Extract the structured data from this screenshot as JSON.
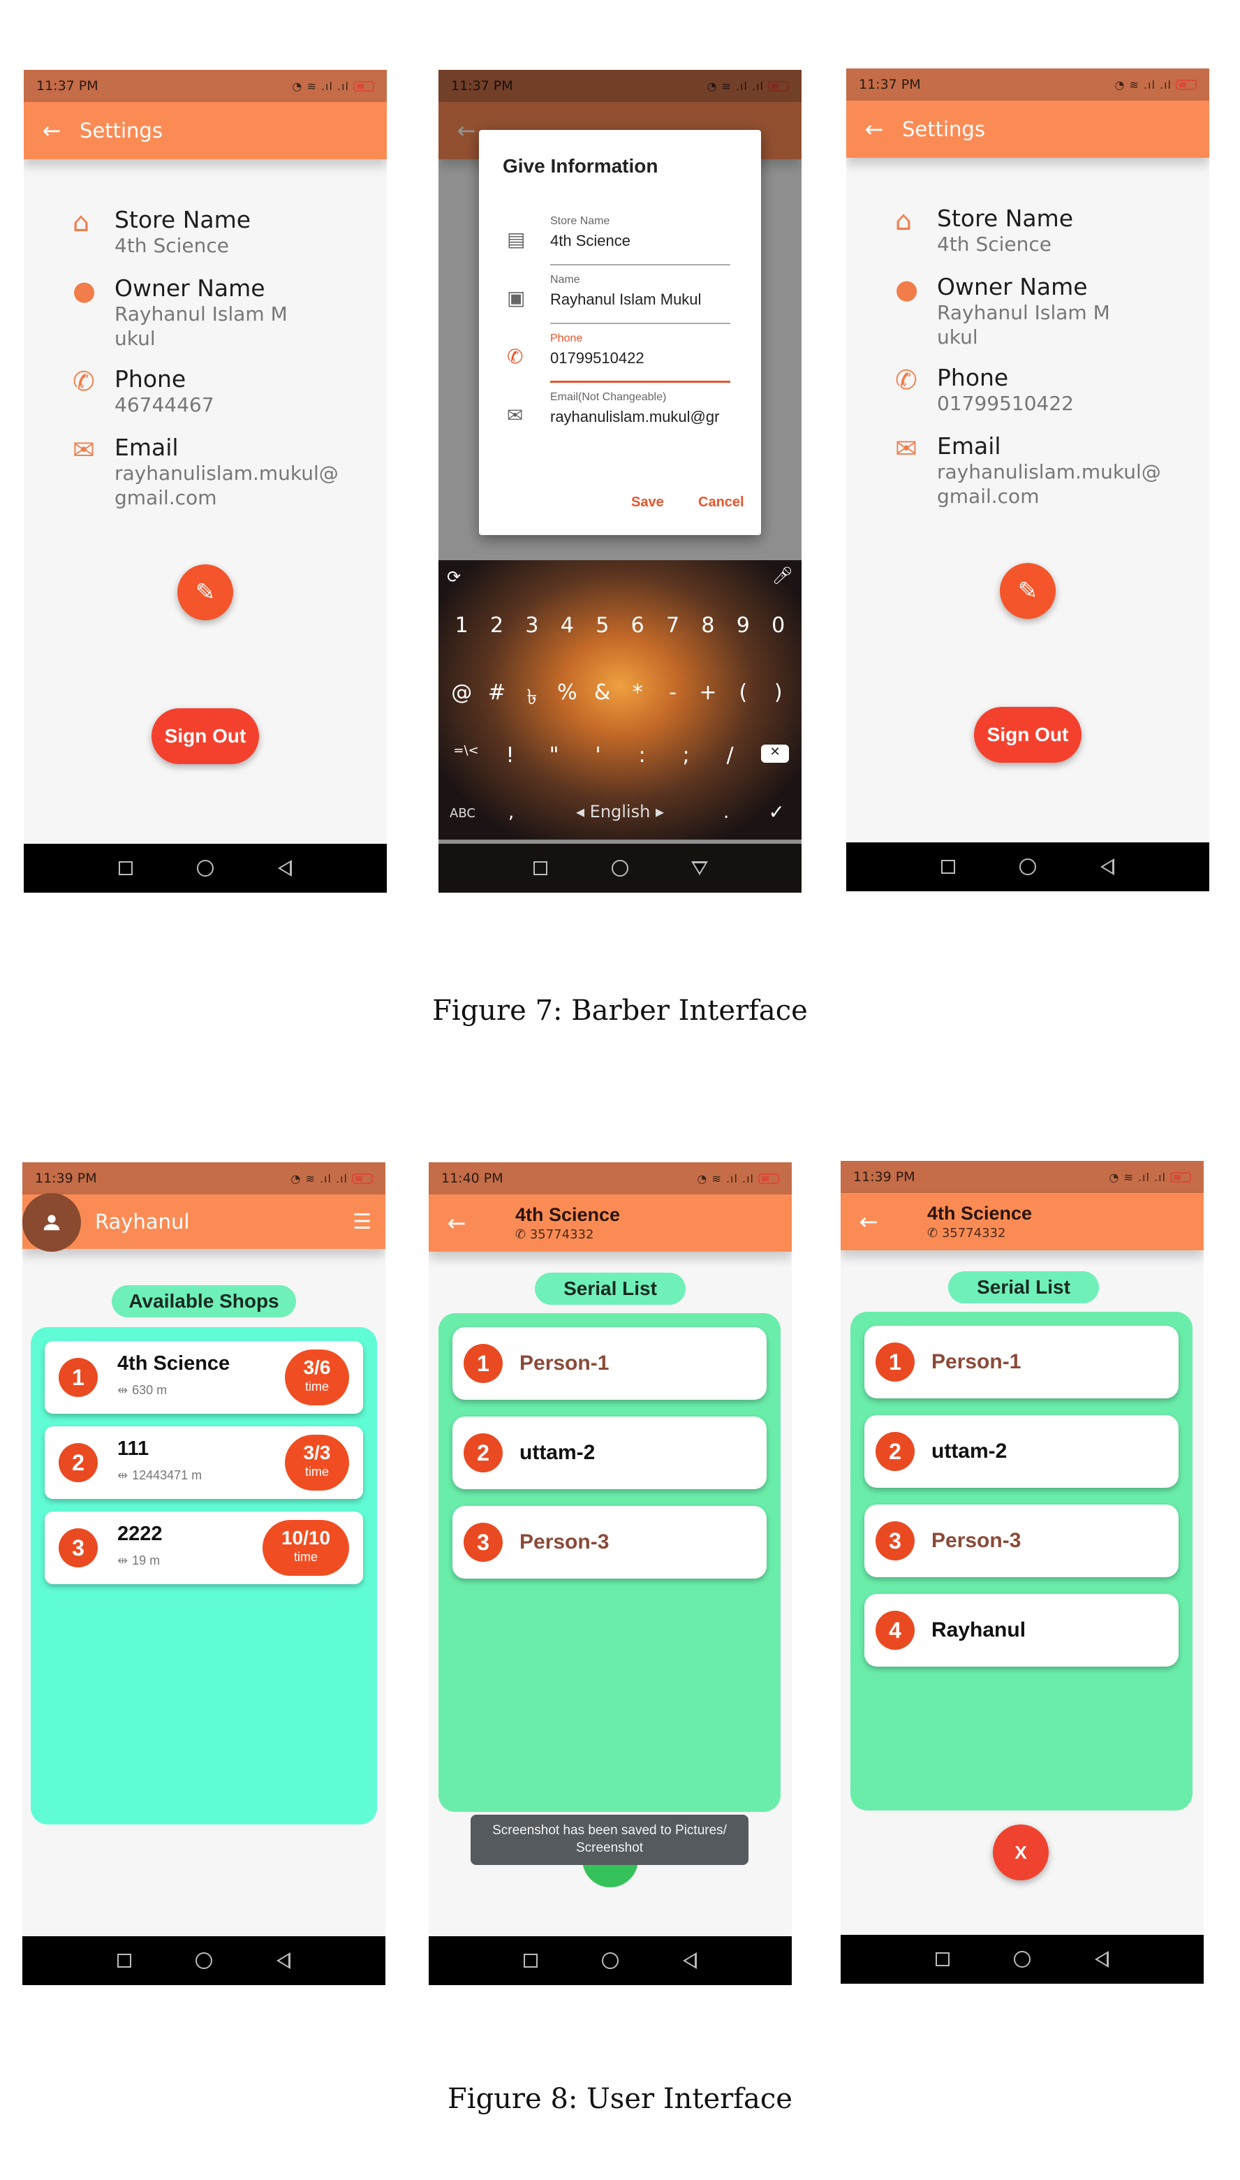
{
  "status": {
    "time_1137": "11:37 PM",
    "time_1139": "11:39 PM",
    "time_1140": "11:40 PM"
  },
  "settings": {
    "title": "Settings",
    "store_label": "Store Name",
    "store_value": "4th Science",
    "owner_label": "Owner Name",
    "owner_value": "Rayhanul Islam Mukul",
    "phone_label": "Phone",
    "phone_value_before": "46744467",
    "phone_value_after": "01799510422",
    "email_label": "Email",
    "email_value": "rayhanulislam.mukul@gmail.com",
    "sign_out": "Sign Out"
  },
  "dialog": {
    "title": "Give Information",
    "fields": [
      {
        "label": "Store Name",
        "value": "4th Science"
      },
      {
        "label": "Name",
        "value": "Rayhanul Islam Mukul"
      },
      {
        "label": "Phone",
        "value": "01799510422"
      },
      {
        "label": "Email(Not Changeable)",
        "value": "rayhanulislam.mukul@gr"
      }
    ],
    "save": "Save",
    "cancel": "Cancel"
  },
  "keyboard": {
    "digits": [
      "1",
      "2",
      "3",
      "4",
      "5",
      "6",
      "7",
      "8",
      "9",
      "0"
    ],
    "symbols_row": [
      "@",
      "#",
      "৳",
      "%",
      "&",
      "*",
      "-",
      "+",
      "(",
      ")"
    ],
    "punct_row": [
      "=\\<",
      "!",
      "\"",
      "'",
      ":",
      ";",
      "/",
      "?"
    ],
    "abc": "ABC",
    "comma": ",",
    "space_label": "English",
    "period": "."
  },
  "captions": {
    "fig7": "Figure 7: Barber Interface",
    "fig8": "Figure 8: User Interface"
  },
  "user": {
    "name": "Rayhanul",
    "available_shops": "Available Shops",
    "shops": [
      {
        "num": "1",
        "name": "4th Science",
        "dist": "630 m",
        "badge": "3/6",
        "badge_sub": "time"
      },
      {
        "num": "2",
        "name": "111",
        "dist": "12443471 m",
        "badge": "3/3",
        "badge_sub": "time"
      },
      {
        "num": "3",
        "name": "2222",
        "dist": "19 m",
        "badge": "10/10",
        "badge_sub": "time"
      }
    ]
  },
  "serial": {
    "shop_title": "4th Science",
    "shop_phone": "35774332",
    "list_title": "Serial List",
    "list_a": [
      {
        "num": "1",
        "name": "Person-1"
      },
      {
        "num": "2",
        "name": "uttam-2"
      },
      {
        "num": "3",
        "name": "Person-3"
      }
    ],
    "list_b": [
      {
        "num": "1",
        "name": "Person-1"
      },
      {
        "num": "2",
        "name": "uttam-2"
      },
      {
        "num": "3",
        "name": "Person-3"
      },
      {
        "num": "4",
        "name": "Rayhanul"
      }
    ],
    "toast": "Screenshot has been saved to Pictures/ Screenshot",
    "cancel_fab": "X"
  },
  "colors": {
    "appbar": "#fb8b55",
    "status": "#c46d48",
    "accent": "#f4552a",
    "shops_panel": "#60fcd6",
    "serial_panel": "#6aedaa"
  }
}
